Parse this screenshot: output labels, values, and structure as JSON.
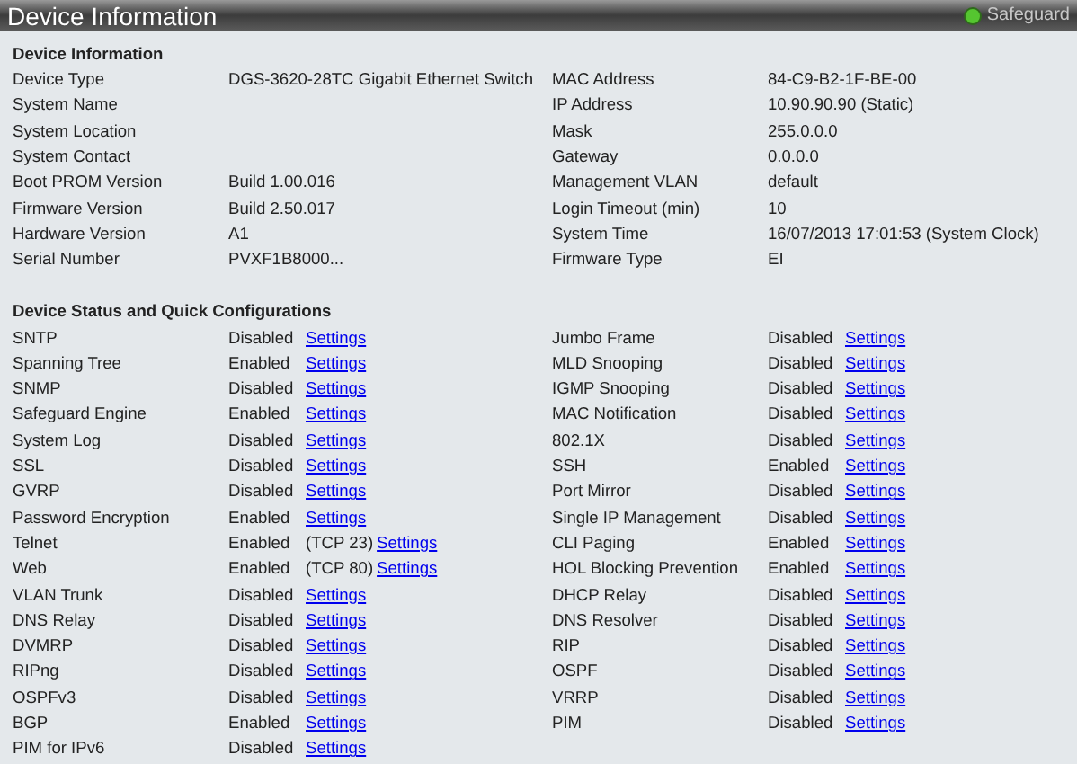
{
  "header": {
    "title": "Device Information",
    "indicator": "Safeguard"
  },
  "device_information": {
    "title": "Device Information",
    "left": [
      {
        "label": "Device Type",
        "value": "DGS-3620-28TC Gigabit Ethernet Switch"
      },
      {
        "label": "System Name"
      },
      {
        "label": "System Location"
      },
      {
        "label": "System Contact"
      },
      {
        "label": "Boot PROM Version",
        "value": "Build 1.00.016"
      },
      {
        "label": "Firmware Version",
        "value": "Build 2.50.017"
      },
      {
        "label": "Hardware Version",
        "value": "A1"
      },
      {
        "label": "Serial Number",
        "value": "PVXF1B8000..."
      }
    ],
    "right": [
      {
        "label": "MAC Address",
        "value": "84-C9-B2-1F-BE-00"
      },
      {
        "label": "IP Address",
        "value": "10.90.90.90 (Static)"
      },
      {
        "label": "Mask",
        "value": "255.0.0.0"
      },
      {
        "label": "Gateway",
        "value": "0.0.0.0"
      },
      {
        "label": "Management VLAN",
        "value": "default"
      },
      {
        "label": "Login Timeout (min)",
        "value": "10"
      },
      {
        "label": "System Time",
        "value": "16/07/2013 17:01:53 (System Clock)"
      },
      {
        "label": "Firmware Type",
        "value": "EI"
      }
    ]
  },
  "device_status": {
    "title": "Device Status and Quick Configurations",
    "left": [
      {
        "name": "SNTP",
        "status": "Disabled",
        "link": "Settings"
      },
      {
        "name": "Spanning Tree",
        "status": "Enabled",
        "link": "Settings"
      },
      {
        "name": "SNMP",
        "status": "Disabled",
        "link": "Settings"
      },
      {
        "name": "Safeguard Engine",
        "status": "Enabled",
        "link": "Settings"
      },
      {
        "name": "System Log",
        "status": "Disabled",
        "link": "Settings"
      },
      {
        "name": "SSL",
        "status": "Disabled",
        "link": "Settings"
      },
      {
        "name": "GVRP",
        "status": "Disabled",
        "link": "Settings"
      },
      {
        "name": "Password Encryption",
        "status": "Enabled",
        "link": "Settings"
      },
      {
        "name": "Telnet",
        "status": "Enabled",
        "note": "(TCP 23)",
        "link": "Settings"
      },
      {
        "name": "Web",
        "status": "Enabled",
        "note": "(TCP 80)",
        "link": "Settings"
      },
      {
        "name": "VLAN Trunk",
        "status": "Disabled",
        "link": "Settings"
      },
      {
        "name": "DNS Relay",
        "status": "Disabled",
        "link": "Settings"
      },
      {
        "name": "DVMRP",
        "status": "Disabled",
        "link": "Settings"
      },
      {
        "name": "RIPng",
        "status": "Disabled",
        "link": "Settings"
      },
      {
        "name": "OSPFv3",
        "status": "Disabled",
        "link": "Settings"
      },
      {
        "name": "BGP",
        "status": "Enabled",
        "link": "Settings"
      },
      {
        "name": "PIM for IPv6",
        "status": "Disabled",
        "link": "Settings"
      }
    ],
    "right": [
      {
        "name": "Jumbo Frame",
        "status": "Disabled",
        "link": "Settings"
      },
      {
        "name": "MLD Snooping",
        "status": "Disabled",
        "link": "Settings"
      },
      {
        "name": "IGMP Snooping",
        "status": "Disabled",
        "link": "Settings"
      },
      {
        "name": "MAC Notification",
        "status": "Disabled",
        "link": "Settings"
      },
      {
        "name": "802.1X",
        "status": "Disabled",
        "link": "Settings"
      },
      {
        "name": "SSH",
        "status": "Enabled",
        "link": "Settings"
      },
      {
        "name": "Port Mirror",
        "status": "Disabled",
        "link": "Settings"
      },
      {
        "name": "Single IP Management",
        "status": "Disabled",
        "link": "Settings"
      },
      {
        "name": "CLI Paging",
        "status": "Enabled",
        "link": "Settings"
      },
      {
        "name": "HOL Blocking Prevention",
        "status": "Enabled",
        "link": "Settings"
      },
      {
        "name": "DHCP Relay",
        "status": "Disabled",
        "link": "Settings"
      },
      {
        "name": "DNS Resolver",
        "status": "Disabled",
        "link": "Settings"
      },
      {
        "name": "RIP",
        "status": "Disabled",
        "link": "Settings"
      },
      {
        "name": "OSPF",
        "status": "Disabled",
        "link": "Settings"
      },
      {
        "name": "VRRP",
        "status": "Disabled",
        "link": "Settings"
      },
      {
        "name": "PIM",
        "status": "Disabled",
        "link": "Settings"
      }
    ]
  }
}
